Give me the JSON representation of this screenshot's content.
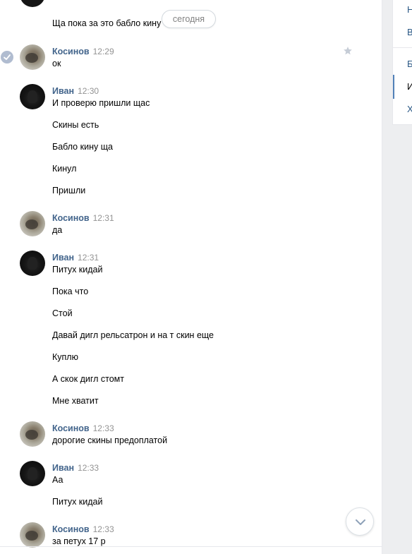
{
  "date_separator": "сегодня",
  "top_partial_message": "Ща пока за это бабло кину",
  "messages": [
    {
      "sender": "Косинов",
      "time": "12:29",
      "lines": [
        "ок"
      ]
    },
    {
      "sender": "Иван",
      "time": "12:30",
      "lines": [
        "И проверю пришли щас",
        "Скины есть",
        "Бабло кину ща",
        "Кинул",
        "Пришли"
      ]
    },
    {
      "sender": "Косинов",
      "time": "12:31",
      "lines": [
        "да"
      ]
    },
    {
      "sender": "Иван",
      "time": "12:31",
      "lines": [
        "Питух кидай",
        "Пока что",
        "Стой",
        "Давай дигл рельсатрон и на т скин еще",
        "Куплю",
        "А скок дигл стомт",
        "Мне хватит"
      ]
    },
    {
      "sender": "Косинов",
      "time": "12:33",
      "lines": [
        "дорогие скины предоплатой"
      ]
    },
    {
      "sender": "Иван",
      "time": "12:33",
      "lines": [
        "Аа",
        "Питух кидай"
      ]
    },
    {
      "sender": "Косинов",
      "time": "12:33",
      "lines": [
        "за петух 17 р"
      ]
    }
  ],
  "sidebar": {
    "items": [
      "Н",
      "В",
      "Б",
      "И",
      "Х"
    ]
  },
  "colors": {
    "link": "#42648b",
    "accent": "#5181b8",
    "time": "#939393"
  }
}
